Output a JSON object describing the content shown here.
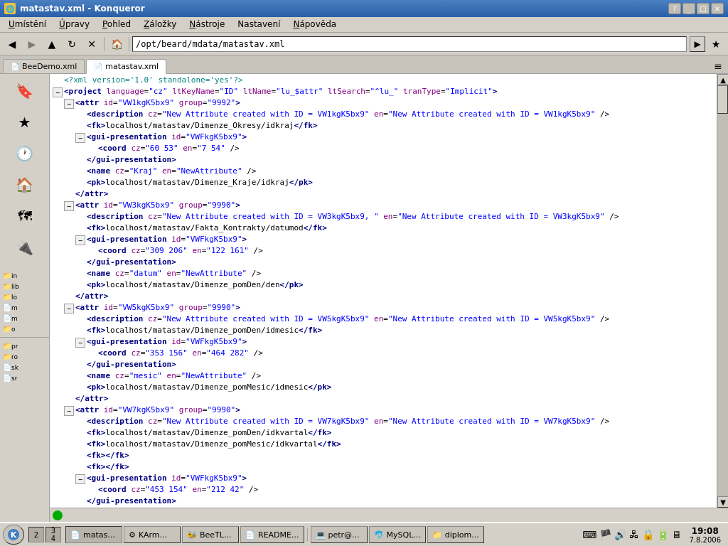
{
  "titlebar": {
    "title": "matastav.xml - Konqueror",
    "icon": "🌐"
  },
  "menubar": {
    "items": [
      "Umístění",
      "Úpravy",
      "Pohled",
      "Záložky",
      "Nástroje",
      "Nastavení",
      "Nápověda"
    ]
  },
  "toolbar": {
    "address": "/opt/beard/mdata/matastav.xml",
    "address_placeholder": "/opt/beard/mdata/matastav.xml"
  },
  "tabs": [
    {
      "label": "BeeDemo.xml",
      "active": false
    },
    {
      "label": "matastav.xml",
      "active": true
    }
  ],
  "xml": {
    "content": [
      {
        "indent": 0,
        "fold": false,
        "text": "<?xml version='1.0' standalone='yes'?>"
      },
      {
        "indent": 0,
        "fold": true,
        "text": "<project language=\"cz\" ltKeyName=\"ID\" ltName=\"lu_$attr\" ltSearch=\"^lu_\" tranType=\"Implicit\">"
      },
      {
        "indent": 1,
        "fold": true,
        "text": "<attr id=\"VW1kgK5bx9\" group=\"9992\">"
      },
      {
        "indent": 2,
        "fold": false,
        "text": "<description cz=\"New Attribute created with ID = VW1kgK5bx9\" en=\"New Attribute created with ID = VW1kgK5bx9\" />"
      },
      {
        "indent": 2,
        "fold": false,
        "text": "<fk>localhost/matastav/Dimenze_Okresy/idkraj</fk>"
      },
      {
        "indent": 2,
        "fold": true,
        "text": "<gui-presentation id=\"VWFkgK5bx9\">"
      },
      {
        "indent": 3,
        "fold": false,
        "text": "<coord cz=\"60 53\" en=\"7 54\" />"
      },
      {
        "indent": 2,
        "fold": false,
        "text": "</gui-presentation>"
      },
      {
        "indent": 2,
        "fold": false,
        "text": "<name cz=\"Kraj\" en=\"NewAttribute\" />"
      },
      {
        "indent": 2,
        "fold": false,
        "text": "<pk>localhost/matastav/Dimenze_Kraje/idkraj</pk>"
      },
      {
        "indent": 1,
        "fold": false,
        "text": "</attr>"
      },
      {
        "indent": 1,
        "fold": true,
        "text": "<attr id=\"VW3kgK5bx9\" group=\"9990\">"
      },
      {
        "indent": 2,
        "fold": false,
        "text": "<description cz=\"New Attribute created with ID = VW3kgK5bx9, \" en=\"New Attribute created with ID = VW3kgK5bx9\" />"
      },
      {
        "indent": 2,
        "fold": false,
        "text": "<fk>localhost/matastav/Fakta_Kontrakty/datumod</fk>"
      },
      {
        "indent": 2,
        "fold": true,
        "text": "<gui-presentation id=\"VWFkgK5bx9\">"
      },
      {
        "indent": 3,
        "fold": false,
        "text": "<coord cz=\"309 206\" en=\"122 161\" />"
      },
      {
        "indent": 2,
        "fold": false,
        "text": "</gui-presentation>"
      },
      {
        "indent": 2,
        "fold": false,
        "text": "<name cz=\"datum\" en=\"NewAttribute\" />"
      },
      {
        "indent": 2,
        "fold": false,
        "text": "<pk>localhost/matastav/Dimenze_pomDen/den</pk>"
      },
      {
        "indent": 1,
        "fold": false,
        "text": "</attr>"
      },
      {
        "indent": 1,
        "fold": true,
        "text": "<attr id=\"VW5kgK5bx9\" group=\"9990\">"
      },
      {
        "indent": 2,
        "fold": false,
        "text": "<description cz=\"New Attribute created with ID = VW5kgK5bx9\" en=\"New Attribute created with ID = VW5kgK5bx9\" />"
      },
      {
        "indent": 2,
        "fold": false,
        "text": "<fk>localhost/matastav/Dimenze_pomDen/idmesic</fk>"
      },
      {
        "indent": 2,
        "fold": true,
        "text": "<gui-presentation id=\"VWFkgK5bx9\">"
      },
      {
        "indent": 3,
        "fold": false,
        "text": "<coord cz=\"353 156\" en=\"464 282\" />"
      },
      {
        "indent": 2,
        "fold": false,
        "text": "</gui-presentation>"
      },
      {
        "indent": 2,
        "fold": false,
        "text": "<name cz=\"mesic\" en=\"NewAttribute\" />"
      },
      {
        "indent": 2,
        "fold": false,
        "text": "<pk>localhost/matastav/Dimenze_pomMesic/idmesic</pk>"
      },
      {
        "indent": 1,
        "fold": false,
        "text": "</attr>"
      },
      {
        "indent": 1,
        "fold": true,
        "text": "<attr id=\"VW7kgK5bx9\" group=\"9990\">"
      },
      {
        "indent": 2,
        "fold": false,
        "text": "<description cz=\"New Attribute created with ID = VW7kgK5bx9\" en=\"New Attribute created with ID = VW7kgK5bx9\" />"
      },
      {
        "indent": 2,
        "fold": false,
        "text": "<fk>localhost/matastav/Dimenze_pomDen/idkvartal</fk>"
      },
      {
        "indent": 2,
        "fold": false,
        "text": "<fk>localhost/matastav/Dimenze_pomMesic/idkvartal</fk>"
      },
      {
        "indent": 2,
        "fold": false,
        "text": "<fk></fk>"
      },
      {
        "indent": 2,
        "fold": false,
        "text": "<fk></fk>"
      },
      {
        "indent": 2,
        "fold": true,
        "text": "<gui-presentation id=\"VWFkgK5bx9\">"
      },
      {
        "indent": 3,
        "fold": false,
        "text": "<coord cz=\"453 154\" en=\"212 42\" />"
      },
      {
        "indent": 2,
        "fold": false,
        "text": "</gui-presentation>"
      }
    ]
  },
  "sidebar": {
    "icons": [
      {
        "symbol": "🔖",
        "label": ""
      },
      {
        "symbol": "★",
        "label": ""
      },
      {
        "symbol": "🕐",
        "label": ""
      },
      {
        "symbol": "🏠",
        "label": ""
      },
      {
        "symbol": "🗺",
        "label": ""
      },
      {
        "symbol": "🔌",
        "label": ""
      }
    ]
  },
  "statusbar": {
    "text": ""
  },
  "taskbar": {
    "clock": "19:08",
    "date": "7.8.2006",
    "tasks": [
      {
        "label": "matas...",
        "icon": "📄",
        "active": true
      },
      {
        "label": "KArm...",
        "icon": "⚙"
      },
      {
        "label": "BeeTL...",
        "icon": "🐝"
      },
      {
        "label": "README...",
        "icon": "📄"
      }
    ],
    "system_tasks": [
      {
        "label": "petr@...",
        "icon": "💻"
      },
      {
        "label": "MySQL...",
        "icon": "🐬"
      },
      {
        "label": "diplom...",
        "icon": "📁"
      }
    ]
  }
}
